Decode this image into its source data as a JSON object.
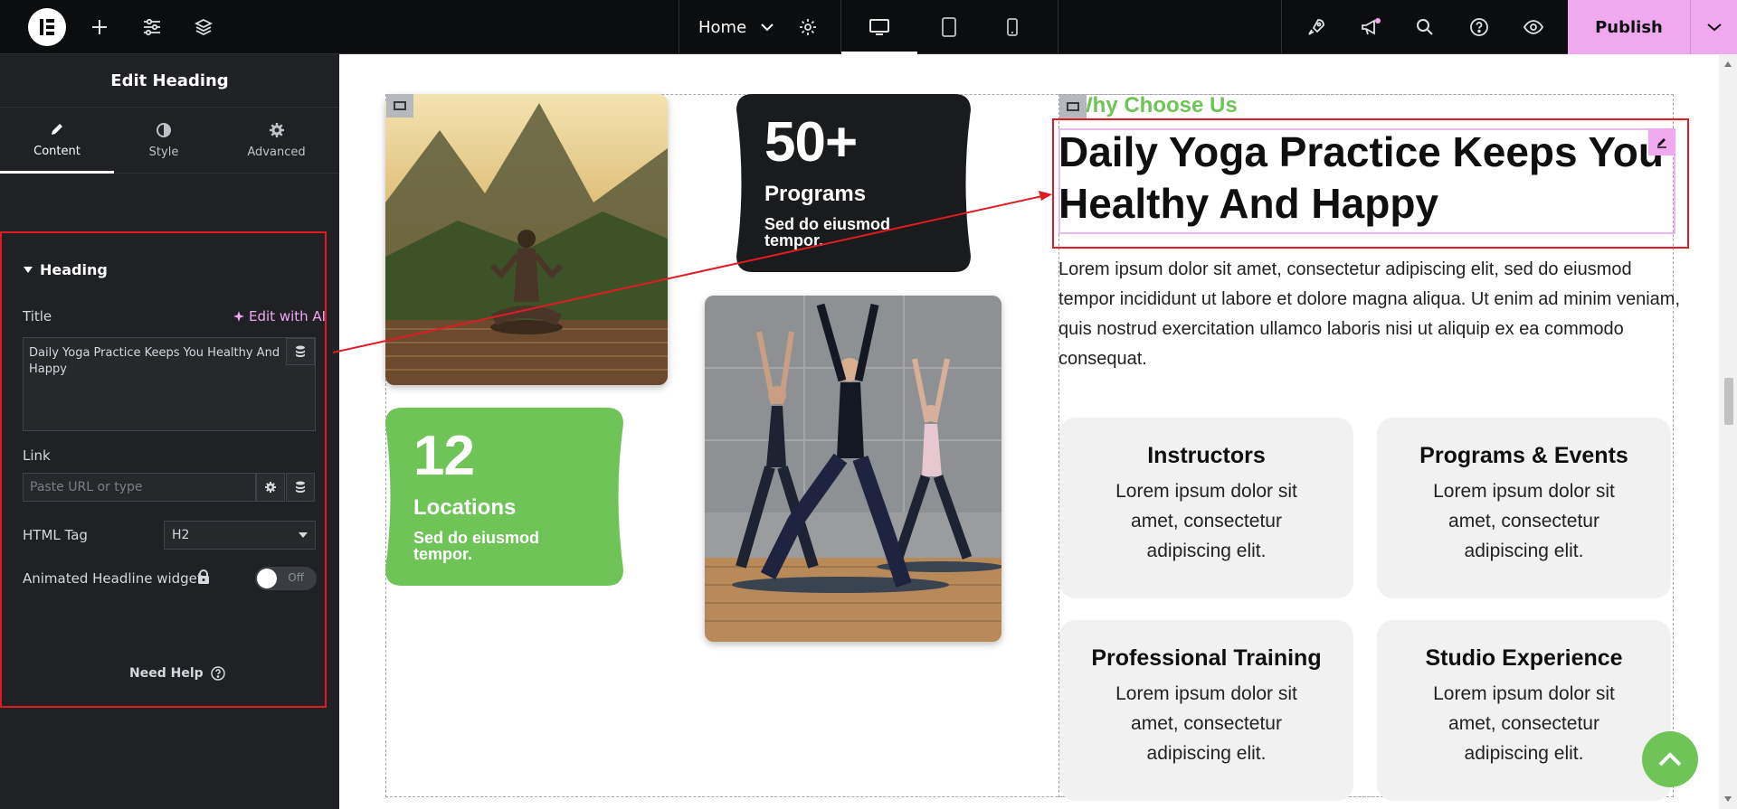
{
  "topbar": {
    "page_selector": "Home",
    "publish_label": "Publish"
  },
  "panel": {
    "title": "Edit Heading",
    "tabs": [
      {
        "label": "Content"
      },
      {
        "label": "Style"
      },
      {
        "label": "Advanced"
      }
    ],
    "section_title": "Heading",
    "title_label": "Title",
    "edit_ai_label": "Edit with AI",
    "title_value": "Daily Yoga Practice Keeps You Healthy And Happy",
    "link_label": "Link",
    "link_placeholder": "Paste URL or type",
    "html_tag_label": "HTML Tag",
    "html_tag_value": "H2",
    "animated_label": "Animated Headline widget",
    "toggle_state": "Off",
    "need_help": "Need Help"
  },
  "canvas": {
    "stats": [
      {
        "number": "50+",
        "label": "Programs",
        "desc": "Sed do eiusmod tempor."
      },
      {
        "number": "12",
        "label": "Locations",
        "desc": "Sed do eiusmod tempor."
      }
    ],
    "eyebrow": "Why Choose Us",
    "heading": "Daily Yoga Practice Keeps You Healthy And Happy",
    "paragraph": "Lorem ipsum dolor sit amet, consectetur adipiscing elit, sed do eiusmod tempor incididunt ut labore et dolore magna aliqua. Ut enim ad minim veniam, quis nostrud exercitation ullamco laboris nisi ut aliquip ex ea commodo consequat.",
    "features": [
      {
        "title": "Instructors",
        "text": "Lorem ipsum dolor sit amet, consectetur adipiscing elit."
      },
      {
        "title": "Programs & Events",
        "text": "Lorem ipsum dolor sit amet, consectetur adipiscing elit."
      },
      {
        "title": "Professional Training",
        "text": "Lorem ipsum dolor sit amet, consectetur adipiscing elit."
      },
      {
        "title": "Studio Experience",
        "text": "Lorem ipsum dolor sit amet, consectetur adipiscing elit."
      }
    ]
  },
  "colors": {
    "accent_pink": "#f0a8ef",
    "brand_green": "#6ec456",
    "dark_card": "#1a1b1c",
    "annotation_red": "#e01b24"
  }
}
